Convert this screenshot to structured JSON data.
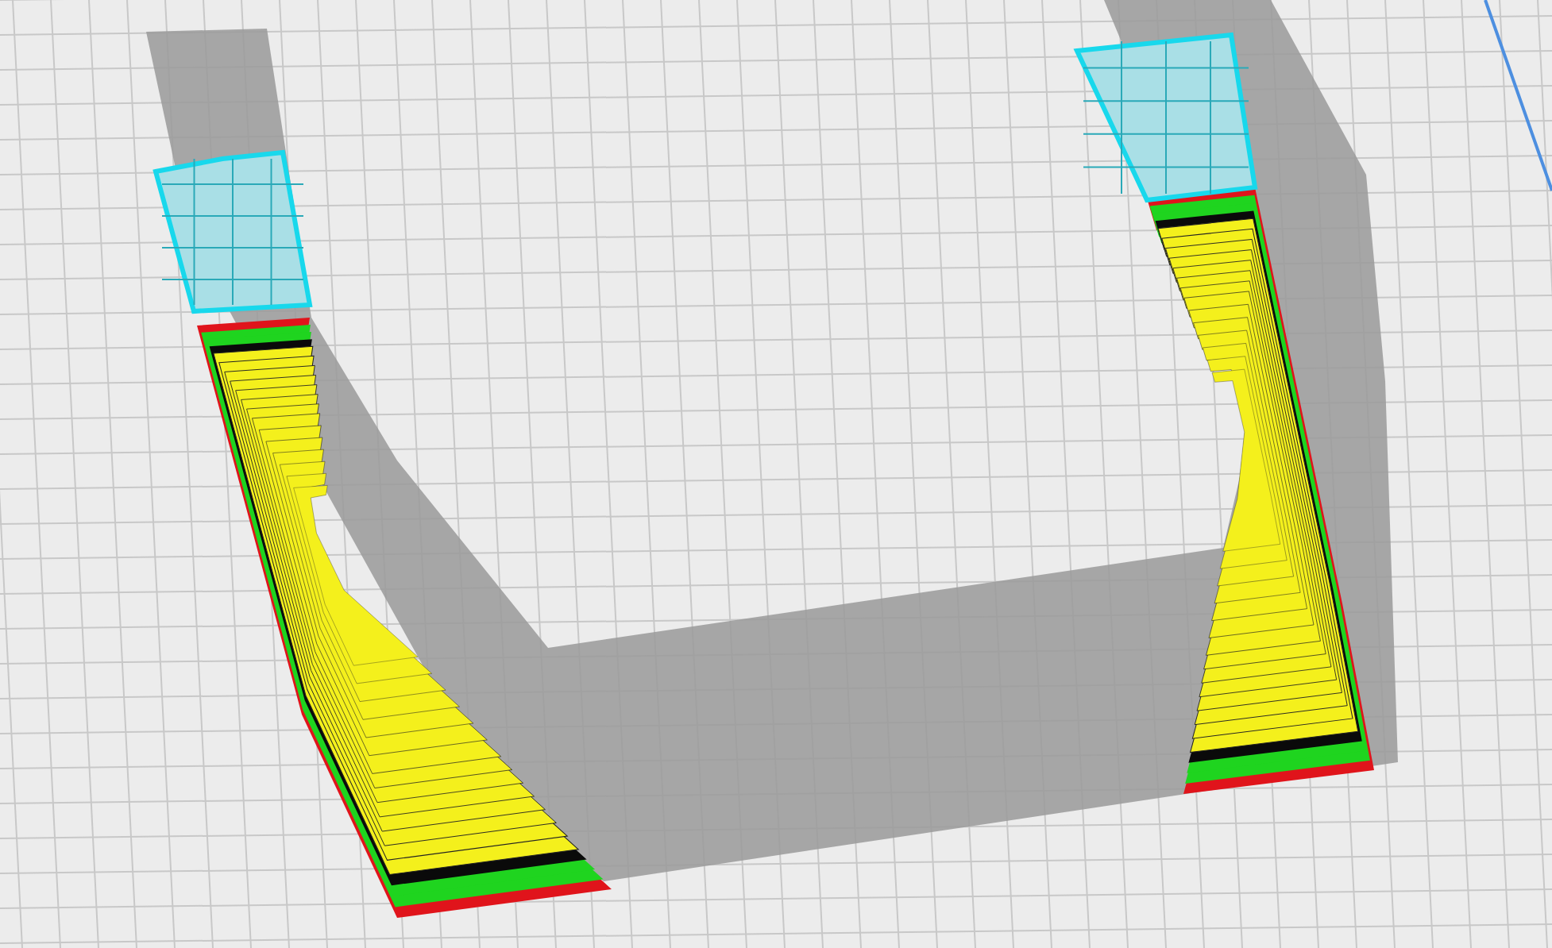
{
  "viewport": {
    "kind": "layer-view"
  }
}
